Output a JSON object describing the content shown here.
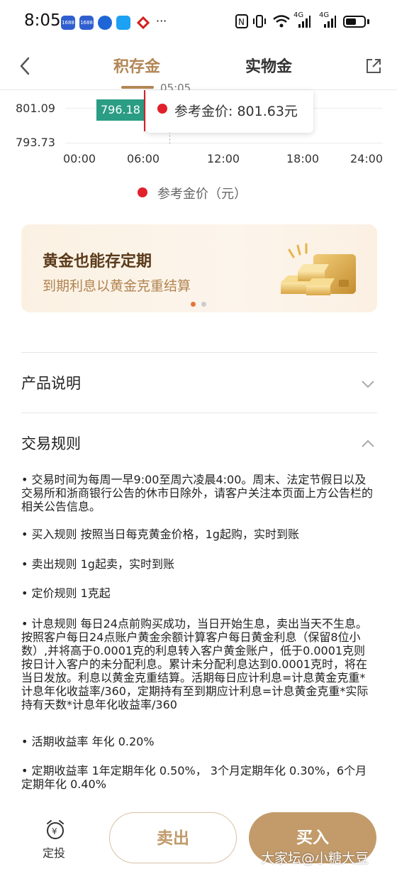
{
  "status_bar": {
    "time": "8:05",
    "app_icons": [
      "1688",
      "1688"
    ],
    "dots": "···",
    "network_1": "4G",
    "network_2": "4G",
    "battery_level": 0.6
  },
  "nav": {
    "tabs": [
      {
        "label": "积存金",
        "active": true
      },
      {
        "label": "实物金",
        "active": false
      }
    ]
  },
  "chart_data": {
    "type": "line",
    "y_ticks": [
      "801.09",
      "793.73"
    ],
    "x_ticks": [
      "00:00",
      "06:00",
      "12:00",
      "18:00",
      "24:00"
    ],
    "current_price_tag": "796.18",
    "tooltip": {
      "time_partial": "05:05",
      "label": "参考金价: 801.63元"
    },
    "legend": [
      {
        "name": "参考金价（元）",
        "color": "#e0202a"
      }
    ]
  },
  "banner": {
    "title": "黄金也能存定期",
    "subtitle": "到期利息以黄金克重结算",
    "page_count": 2,
    "active_index": 0
  },
  "sections": {
    "product": {
      "title": "产品说明",
      "expanded": false
    },
    "rules": {
      "title": "交易规则",
      "expanded": true
    }
  },
  "rules": [
    "•  交易时间为每周一早9:00至周六凌晨4:00。周末、法定节假日以及交易所和浙商银行公告的休市日除外，请客户关注本页面上方公告栏的相关公告信息。",
    "•  买入规则 按照当日每克黄金价格，1g起购，实时到账",
    "•  卖出规则 1g起卖，实时到账",
    "•  定价规则 1克起",
    "•  计息规则 每日24点前购买成功，当日开始生息，卖出当天不生息。按照客户每日24点账户黄金余额计算客户每日黄金利息（保留8位小数）,并将高于0.0001克的利息转入客户黄金账户，低于0.0001克则按日计入客户的未分配利息。累计未分配利息达到0.0001克时，将在当日发放。利息以黄金克重结算。活期每日应计利息=计息黄金克重*计息年化收益率/360，定期持有至到期应计利息=计息黄金克重*实际持有天数*计息年化收益率/360",
    "•  活期收益率 年化 0.20%",
    "•  定期收益率  1年定期年化 0.50%， 3个月定期年化 0.30%，6个月定期年化 0.40%"
  ],
  "bottom_bar": {
    "dingtou_label": "定投",
    "sell_label": "卖出",
    "buy_label": "买入",
    "watermark": "大家坛@小糖大豆"
  },
  "colors": {
    "accent": "#b38756",
    "buy": "#c39a69",
    "price_tag": "#2a9d84",
    "reference": "#e0202a"
  }
}
